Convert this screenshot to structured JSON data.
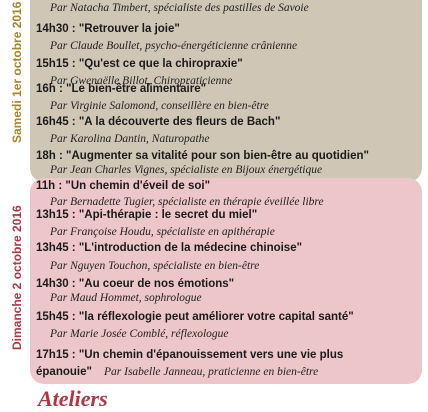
{
  "saturday": {
    "day_label": "Samedi 1er octobre 2016",
    "items": [
      {
        "talk": "",
        "speaker": "Par Natacha Timbert, spécialiste des pastilles de Savoie"
      },
      {
        "talk": "14h30 : \"Retrouver la joie\"",
        "speaker": "Par Claude Boullet, psycho-énergéticienne crânienne"
      },
      {
        "talk": "15h15 : \"Qu'est ce que la chiropraxie\"",
        "speaker": "Par Gwenaëlle Billot, Chiropraticienne"
      },
      {
        "talk": "16h : \"Le bien-être alimentaire\"",
        "speaker": "Par Virginie Salomond, conseillère en bien-être"
      },
      {
        "talk": "16h45 : \"A la découverte des fleurs de Bach\"",
        "speaker": "Par Karolina Dantin, Naturopathe"
      },
      {
        "talk": "18h : \"Augmenter sa vitalité pour son bien-être au quotidien\"",
        "speaker": "Par Jean Charles Vignes, spécialiste en Bijoux énergétique"
      }
    ]
  },
  "sunday": {
    "day_label": "Dimanche 2 octobre 2016",
    "items": [
      {
        "talk": "11h : \"Un chemin d'éveil de soi\"",
        "speaker": "Par Bernadette Tugier, spécialiste en thérapie éveillée libre"
      },
      {
        "talk": "13h15 : \"Api-thérapie : le secret du miel\"",
        "speaker": "Par Françoise Houdu, spécialiste en apithérapie"
      },
      {
        "talk": "13h45 : \"L'introduction de la médecine chinoise\"",
        "speaker": "Par Nguyen Touchon, spécialiste en bien-être"
      },
      {
        "talk": "14h30 : \"Au coeur de nos émotions\"",
        "speaker": "Par Maud Hommet, sophrologue"
      },
      {
        "talk": "15h45 : \"la réflexologie peut améliorer votre capital santé\"",
        "speaker": "Par Marie Josée Comblé, réflexologue"
      },
      {
        "talk": "17h15 : \"Un chemin d'épanouissement vers une vie plus",
        "speaker": ""
      },
      {
        "talk": "épanouie\"",
        "speaker": "Par Isabelle Janneau, praticienne en bien-être"
      }
    ]
  },
  "footer": {
    "title": "Ateliers"
  },
  "colors": {
    "saturday_bg": "#cfc6b5",
    "sunday_bg": "#ecc6c8",
    "saturday_label": "#a6862a",
    "sunday_label": "#b03642"
  }
}
